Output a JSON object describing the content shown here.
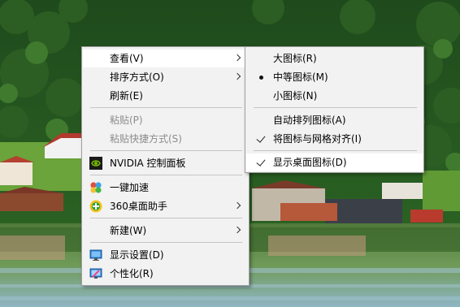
{
  "context_menu": {
    "items": [
      {
        "label": "查看(V)"
      },
      {
        "label": "排序方式(O)"
      },
      {
        "label": "刷新(E)"
      },
      {
        "label": "粘贴(P)"
      },
      {
        "label": "粘贴快捷方式(S)"
      },
      {
        "label": "NVIDIA 控制面板",
        "icon": "nvidia-icon"
      },
      {
        "label": "一键加速",
        "icon": "speedup-icon"
      },
      {
        "label": "360桌面助手",
        "icon": "desktop-assistant-icon"
      },
      {
        "label": "新建(W)"
      },
      {
        "label": "显示设置(D)",
        "icon": "display-settings-icon"
      },
      {
        "label": "个性化(R)",
        "icon": "personalize-icon"
      }
    ]
  },
  "view_submenu": {
    "items": [
      {
        "label": "大图标(R)",
        "mark": ""
      },
      {
        "label": "中等图标(M)",
        "mark": "bullet"
      },
      {
        "label": "小图标(N)",
        "mark": ""
      },
      {
        "label": "自动排列图标(A)",
        "mark": ""
      },
      {
        "label": "将图标与网格对齐(I)",
        "mark": "check"
      },
      {
        "label": "显示桌面图标(D)",
        "mark": "check"
      }
    ]
  },
  "colors": {
    "menu_bg": "#f2f2f2",
    "highlight": "#ffffff",
    "disabled_text": "#8c8c8c",
    "nvidia_green": "#76b900"
  }
}
